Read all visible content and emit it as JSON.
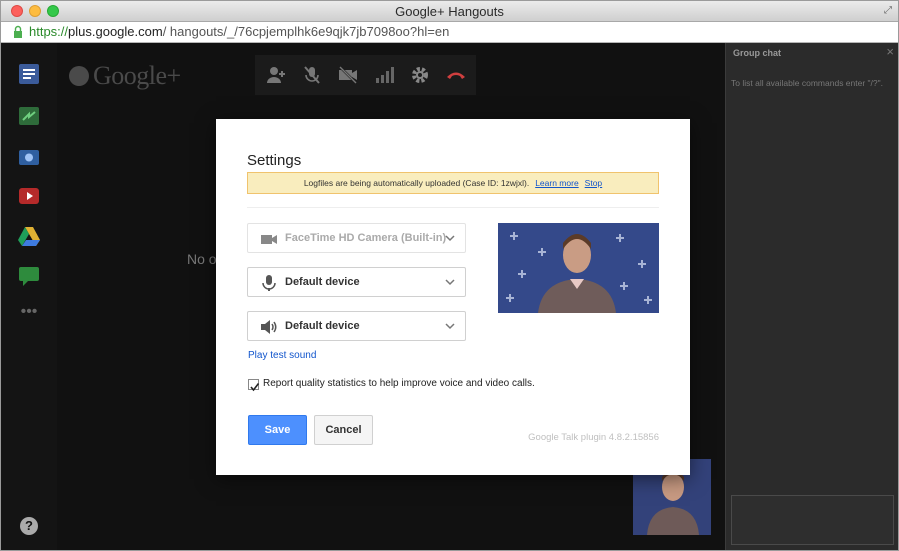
{
  "window": {
    "title": "Google+ Hangouts"
  },
  "urlbar": {
    "scheme": "https://",
    "host": "plus.google.com",
    "path": "/ hangouts/_/76cpjemplhk6e9qjk7jb7098oo?hl=en"
  },
  "app": {
    "logo": "Google+",
    "no_others_text": "No o",
    "toolbar_icons": [
      "invite-people-icon",
      "mute-mic-icon",
      "camera-off-icon",
      "bandwidth-icon",
      "settings-gear-icon",
      "hang-up-icon"
    ],
    "sidebar_icons": [
      "hangouts-icon",
      "share-icon",
      "camera-icon",
      "youtube-icon",
      "drive-icon",
      "chat-icon",
      "more-icon"
    ],
    "help_label": "?"
  },
  "chat": {
    "title": "Group chat",
    "close": "×",
    "hint": "To list all available commands enter \"/?\"."
  },
  "dialog": {
    "title": "Settings",
    "notice": {
      "text": "Logfiles are being automatically uploaded (Case ID: 1zwjxl).",
      "learn_more": "Learn more",
      "stop": "Stop"
    },
    "camera": {
      "label": "FaceTime HD Camera (Built-in)",
      "icon": "video-camera-icon"
    },
    "microphone": {
      "label": "Default device",
      "icon": "microphone-icon"
    },
    "speaker": {
      "label": "Default device",
      "icon": "speaker-icon"
    },
    "play_test_sound": "Play test sound",
    "report_checkbox": {
      "checked": true,
      "label": "Report quality statistics to help improve voice and video calls."
    },
    "save_label": "Save",
    "cancel_label": "Cancel",
    "version": "Google Talk plugin 4.8.2.15856"
  },
  "colors": {
    "primary_button": "#4d90fe",
    "notice_bg": "#f9edbe",
    "link": "#1155cc",
    "hangup": "#d03f3f"
  }
}
